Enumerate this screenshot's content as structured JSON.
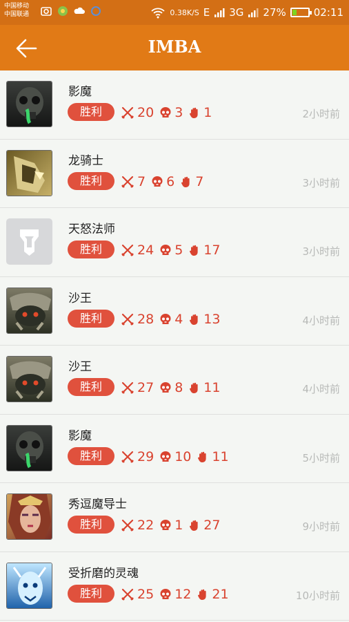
{
  "status_bar": {
    "carrier_1": "中国移动",
    "carrier_2": "中国联通",
    "network_speed": "0.38K/S",
    "net_type_1": "E",
    "net_type_2": "3G",
    "battery_percent": "27%",
    "battery_level": 0.27,
    "time": "02:11"
  },
  "header": {
    "title": "IMBA"
  },
  "matches": [
    {
      "hero": "影魔",
      "result": "胜利",
      "kills": "20",
      "deaths": "3",
      "assists": "1",
      "time": "2小时前"
    },
    {
      "hero": "龙骑士",
      "result": "胜利",
      "kills": "7",
      "deaths": "6",
      "assists": "7",
      "time": "3小时前"
    },
    {
      "hero": "天怒法师",
      "result": "胜利",
      "kills": "24",
      "deaths": "5",
      "assists": "17",
      "time": "3小时前"
    },
    {
      "hero": "沙王",
      "result": "胜利",
      "kills": "28",
      "deaths": "4",
      "assists": "13",
      "time": "4小时前"
    },
    {
      "hero": "沙王",
      "result": "胜利",
      "kills": "27",
      "deaths": "8",
      "assists": "11",
      "time": "4小时前"
    },
    {
      "hero": "影魔",
      "result": "胜利",
      "kills": "29",
      "deaths": "10",
      "assists": "11",
      "time": "5小时前"
    },
    {
      "hero": "秀逗魔导士",
      "result": "胜利",
      "kills": "22",
      "deaths": "1",
      "assists": "27",
      "time": "9小时前"
    },
    {
      "hero": "受折磨的灵魂",
      "result": "胜利",
      "kills": "25",
      "deaths": "12",
      "assists": "21",
      "time": "10小时前"
    }
  ],
  "colors": {
    "header": "#e17a16",
    "status_bar": "#d36f15",
    "win_badge": "#e0513d",
    "stat_text": "#d9432f"
  }
}
